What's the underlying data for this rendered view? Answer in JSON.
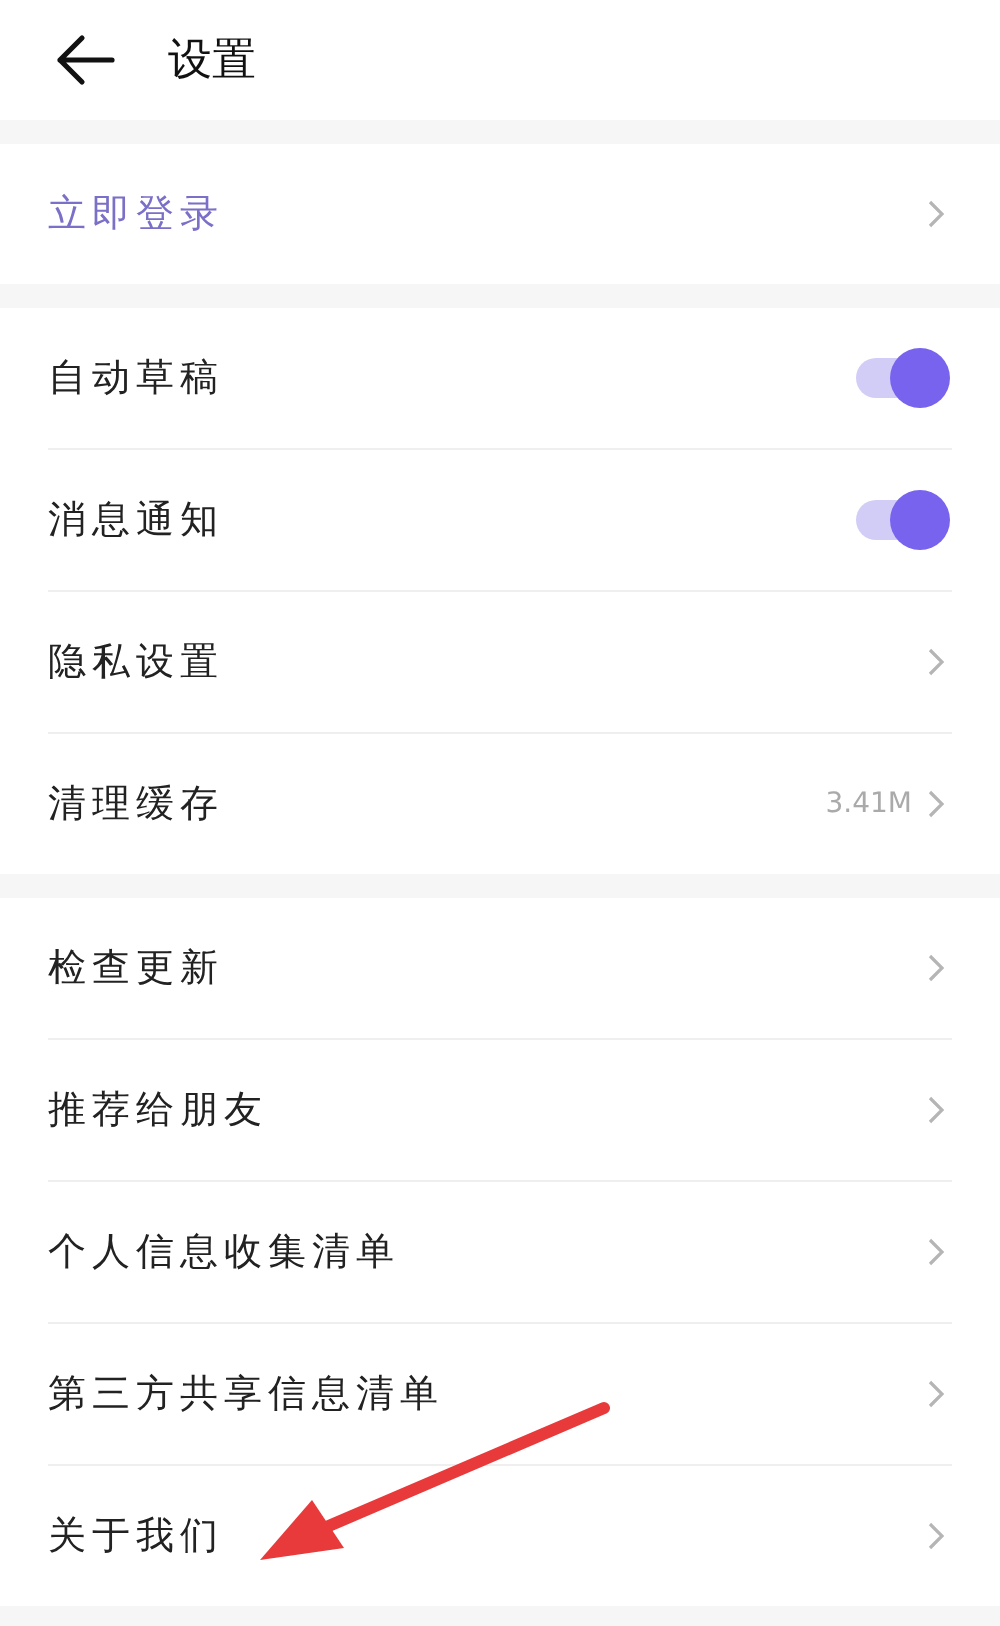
{
  "header": {
    "title": "设置"
  },
  "groups": [
    {
      "items": [
        {
          "kind": "action",
          "label": "立即登录"
        }
      ]
    },
    {
      "items": [
        {
          "kind": "toggle",
          "label": "自动草稿",
          "on": true
        },
        {
          "kind": "toggle",
          "label": "消息通知",
          "on": true
        },
        {
          "kind": "link",
          "label": "隐私设置"
        },
        {
          "kind": "value",
          "label": "清理缓存",
          "value": "3.41M"
        }
      ]
    },
    {
      "items": [
        {
          "kind": "link",
          "label": "检查更新"
        },
        {
          "kind": "link",
          "label": "推荐给朋友"
        },
        {
          "kind": "link",
          "label": "个人信息收集清单"
        },
        {
          "kind": "link",
          "label": "第三方共享信息清单"
        },
        {
          "kind": "link",
          "label": "关于我们"
        }
      ]
    }
  ]
}
